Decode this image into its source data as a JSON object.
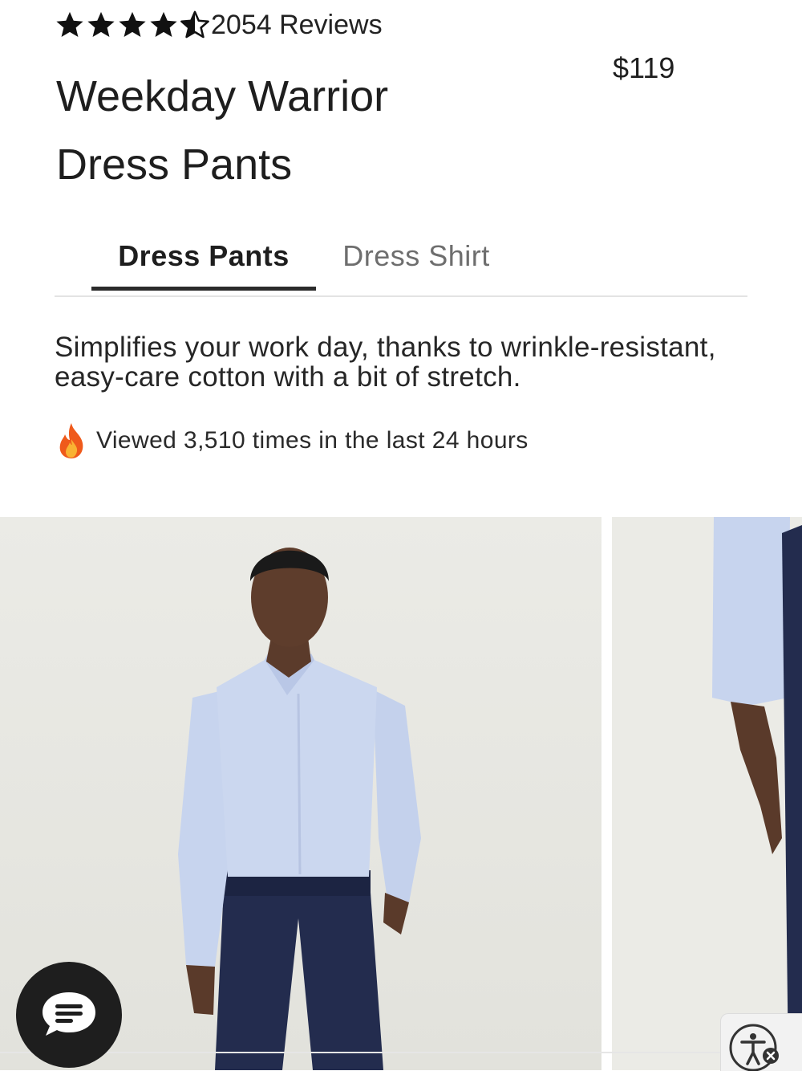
{
  "product": {
    "rating": 4.5,
    "rating_max": 5,
    "review_count_label": "2054 Reviews",
    "title_line1": "Weekday Warrior",
    "title_line2": "Dress Pants",
    "price": "$119"
  },
  "tabs": [
    {
      "label": "Dress Pants",
      "active": true
    },
    {
      "label": "Dress Shirt",
      "active": false
    }
  ],
  "description": "Simplifies your work day, thanks to wrinkle-resistant, easy-care cotton with a bit of stretch.",
  "social_proof": {
    "icon": "flame-icon",
    "text": "Viewed 3,510 times in the last 24 hours"
  },
  "gallery": {
    "images": [
      {
        "subject": "model-front-view",
        "shirt_color": "#c9d6ee",
        "pants_color": "#232c4e"
      },
      {
        "subject": "model-side-partial",
        "shirt_color": "#c9d6ee",
        "pants_color": "#232c4e"
      }
    ]
  },
  "widgets": {
    "chat_icon": "chat-bubble-icon",
    "accessibility_icon": "accessibility-icon"
  },
  "colors": {
    "text": "#1e1e1e",
    "muted": "#6e6e6e",
    "tab_underline": "#2b2b2b",
    "photo_bg": "#ebebe6"
  }
}
